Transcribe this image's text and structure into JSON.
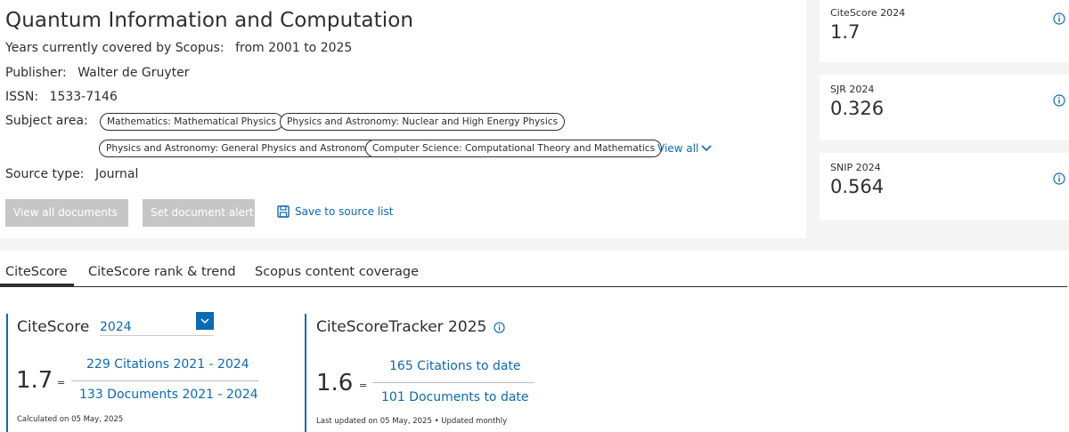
{
  "source": {
    "title": "Quantum Information and Computation",
    "years_label": "Years currently covered by Scopus:",
    "years_value": "from 2001 to 2025",
    "publisher_label": "Publisher:",
    "publisher_value": "Walter de Gruyter",
    "issn_label": "ISSN:",
    "issn_value": "1533-7146",
    "subject_label": "Subject area:",
    "subject_areas": [
      "Mathematics: Mathematical Physics",
      "Physics and Astronomy: Nuclear and High Energy Physics",
      "Physics and Astronomy: General Physics and Astronomy",
      "Computer Science: Computational Theory and Mathematics"
    ],
    "view_all_label": "View all",
    "source_type_label": "Source type:",
    "source_type_value": "Journal"
  },
  "actions": {
    "view_all_documents": "View all documents",
    "set_document_alert": "Set document alert",
    "save_to_source_list": "Save to source list"
  },
  "metrics": [
    {
      "label": "CiteScore 2024",
      "value": "1.7"
    },
    {
      "label": "SJR 2024",
      "value": "0.326"
    },
    {
      "label": "SNIP 2024",
      "value": "0.564"
    }
  ],
  "tabs": [
    {
      "label": "CiteScore",
      "active": true
    },
    {
      "label": "CiteScore rank & trend",
      "active": false
    },
    {
      "label": "Scopus content coverage",
      "active": false
    }
  ],
  "citescore": {
    "title": "CiteScore",
    "year": "2024",
    "value": "1.7",
    "equals": "=",
    "citations": "229 Citations 2021 - 2024",
    "documents": "133 Documents 2021 - 2024",
    "calculated": "Calculated on 05 May, 2025"
  },
  "tracker": {
    "title": "CiteScoreTracker 2025",
    "value": "1.6",
    "equals": "=",
    "citations": "165 Citations to date",
    "documents": "101 Documents to date",
    "updated": "Last updated on 05 May, 2025 • Updated monthly"
  },
  "colors": {
    "link": "#0c69b4",
    "text": "#2e2e2e",
    "disabled_button": "#c6c6c6",
    "panel_bg": "#f4f4f4"
  }
}
